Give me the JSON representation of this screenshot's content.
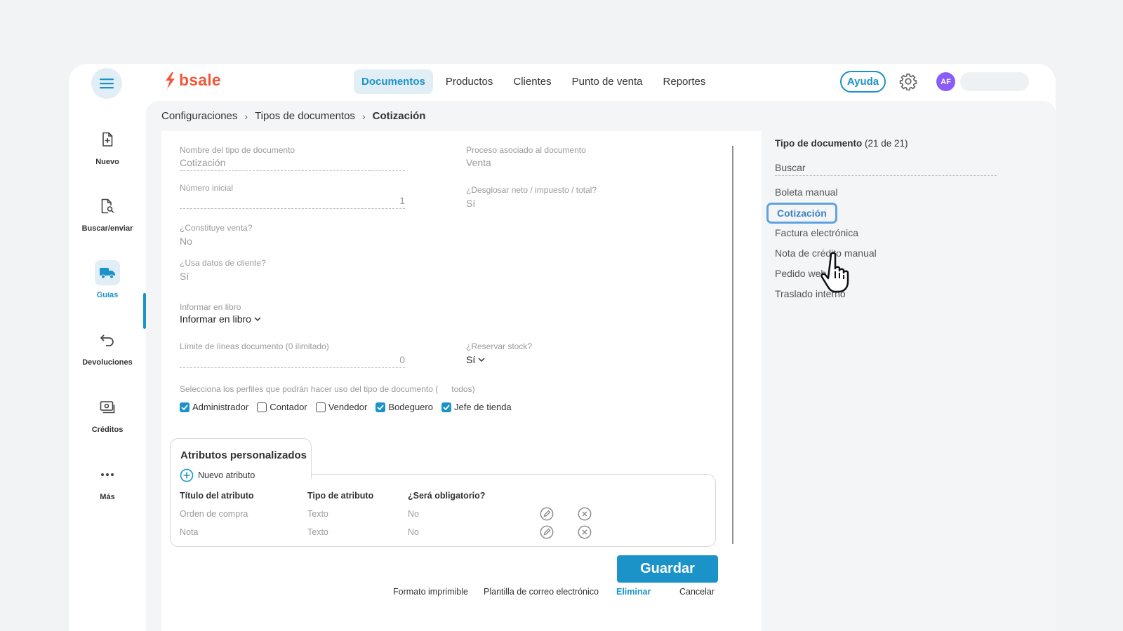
{
  "app": {
    "brand": "bsale"
  },
  "nav": {
    "items": [
      {
        "label": "Documentos",
        "active": true
      },
      {
        "label": "Productos",
        "active": false
      },
      {
        "label": "Clientes",
        "active": false
      },
      {
        "label": "Punto de venta",
        "active": false
      },
      {
        "label": "Reportes",
        "active": false
      }
    ],
    "help_label": "Ayuda",
    "avatar_initials": "AF"
  },
  "sidebar": {
    "items": [
      {
        "label": "Nuevo",
        "icon": "new-document-icon"
      },
      {
        "label": "Buscar/enviar",
        "icon": "search-document-icon"
      },
      {
        "label": "Guías",
        "icon": "truck-icon",
        "active": true
      },
      {
        "label": "Devoluciones",
        "icon": "return-arrow-icon"
      },
      {
        "label": "Créditos",
        "icon": "credits-icon"
      },
      {
        "label": "Más",
        "icon": "more-dots-icon"
      }
    ]
  },
  "breadcrumb": {
    "items": [
      "Configuraciones",
      "Tipos de documentos"
    ],
    "current": "Cotización"
  },
  "form": {
    "nombre": {
      "label": "Nombre del tipo de documento",
      "value": "Cotización"
    },
    "proceso": {
      "label": "Proceso asociado al documento",
      "value": "Venta"
    },
    "numero_inicial": {
      "label": "Número inicial",
      "value": "1"
    },
    "desglosar": {
      "label": "¿Desglosar neto / impuesto / total?",
      "value": "Sí"
    },
    "constituye_venta": {
      "label": "¿Constituye venta?",
      "value": "No"
    },
    "usa_datos_cliente": {
      "label": "¿Usa datos de cliente?",
      "value": "Sí"
    },
    "informar_libro": {
      "label": "Informar en libro",
      "value": "Informar en libro"
    },
    "limite_lineas": {
      "label": "Límite de líneas documento (0 ilimitado)",
      "value": "0"
    },
    "reservar_stock": {
      "label": "¿Reservar stock?",
      "value": "Sí"
    },
    "perfiles": {
      "label_start": "Selecciona los perfiles que podrán hacer uso del tipo de documento (",
      "label_end": "todos)",
      "options": [
        {
          "label": "Administrador",
          "checked": true
        },
        {
          "label": "Contador",
          "checked": false
        },
        {
          "label": "Vendedor",
          "checked": false
        },
        {
          "label": "Bodeguero",
          "checked": true
        },
        {
          "label": "Jefe de tienda",
          "checked": true
        }
      ]
    }
  },
  "attributes": {
    "tab_title": "Atributos personalizados",
    "new_label": "Nuevo atributo",
    "headers": [
      "Título del atributo",
      "Tipo de atributo",
      "¿Será obligatorio?"
    ],
    "rows": [
      {
        "title": "Orden de compra",
        "type": "Texto",
        "required": "No"
      },
      {
        "title": "Nota",
        "type": "Texto",
        "required": "No"
      }
    ]
  },
  "actions": {
    "save": "Guardar",
    "print_format": "Formato imprimible",
    "email_template": "Plantilla de correo electrónico",
    "delete": "Eliminar",
    "cancel": "Cancelar"
  },
  "doc_types": {
    "title_bold": "Tipo de documento",
    "count": "(21 de 21)",
    "search_placeholder": "Buscar",
    "items": [
      {
        "label": "Boleta manual"
      },
      {
        "label": "Cotización",
        "selected": true
      },
      {
        "label": "Factura electrónica"
      },
      {
        "label": "Nota de crédito manual"
      },
      {
        "label": "Pedido web"
      },
      {
        "label": "Traslado interno"
      }
    ]
  },
  "colors": {
    "accent": "#1b93c8",
    "brand": "#f0573b",
    "avatar": "#8b5cf6",
    "selection": "#60a2e0"
  }
}
